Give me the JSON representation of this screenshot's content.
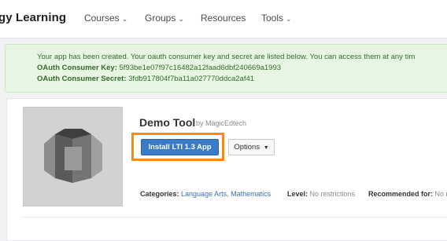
{
  "nav": {
    "brand": "gy Learning",
    "items": [
      {
        "label": "Courses",
        "has_caret": true
      },
      {
        "label": "Groups",
        "has_caret": true
      },
      {
        "label": "Resources",
        "has_caret": false
      },
      {
        "label": "Tools",
        "has_caret": true
      }
    ]
  },
  "alert": {
    "message": "Your app has been created. Your oauth consumer key and secret are listed below. You can access them at any tim",
    "key_label": "OAuth Consumer Key:",
    "key_value": "5f93be1e07f97c16482a12faad6dbf240669a1993",
    "secret_label": "OAuth Consumer Secret:",
    "secret_value": "3fdb917804f7ba11a027770ddca2af41",
    "colors": {
      "background": "#e7f6e2",
      "text": "#356b2b"
    }
  },
  "app": {
    "title": "Demo Tool",
    "by": "by MagicEdtech",
    "install_label": "Install LTI 1.3 App",
    "options_label": "Options",
    "categories_label": "Categories:",
    "categories_value": "Language Arts, Mathematics",
    "level_label": "Level:",
    "level_value": "No restrictions",
    "recommended_label": "Recommended for:",
    "recommended_value": "No r",
    "colors": {
      "install_button": "#3a7bc8",
      "highlight": "#f28c13"
    }
  }
}
